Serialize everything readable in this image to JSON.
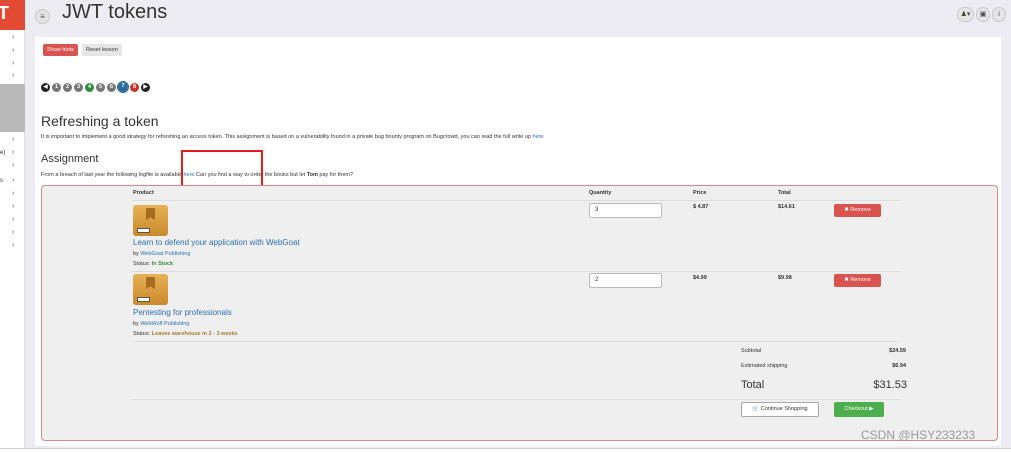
{
  "app": {
    "logo_letter": "T"
  },
  "header": {
    "title": "JWT tokens",
    "menu_glyph": "≡",
    "user_glyph": "♟▾",
    "monitor_glyph": "▣",
    "info_glyph": "i"
  },
  "sidebar": {
    "arrows": [
      "›",
      "›",
      "›",
      "›",
      "›",
      "›",
      "›",
      "›",
      "›",
      "›",
      "›",
      "›",
      "›",
      "›",
      "›"
    ],
    "fragments": [
      "e)",
      "s"
    ]
  },
  "toolbar": {
    "show_hints": "Show hints",
    "reset_lesson": "Reset lesson"
  },
  "pager": {
    "prev": "◀",
    "pages": [
      {
        "label": "1",
        "state": "gray"
      },
      {
        "label": "2",
        "state": "gray"
      },
      {
        "label": "3",
        "state": "gray"
      },
      {
        "label": "4",
        "state": "green"
      },
      {
        "label": "5",
        "state": "gray"
      },
      {
        "label": "6",
        "state": "gray"
      },
      {
        "label": "7",
        "state": "current"
      },
      {
        "label": "8",
        "state": "red"
      }
    ],
    "next": "▶"
  },
  "content": {
    "heading": "Refreshing a token",
    "intro": "It is important to implement a good strategy for refreshing an access token. This assignment is based on a vulnerability found in a private bug bounty program on Bugcrowd, you can read the full write up ",
    "intro_link": "here",
    "assignment_heading": "Assignment",
    "assign_before": "From a breach of last year the following logfile is available ",
    "assign_link": "here",
    "assign_mid": " Can you find a way to order the books but let ",
    "assign_bold": "Tom",
    "assign_after": " pay for them?"
  },
  "cart": {
    "columns": {
      "product": "Product",
      "quantity": "Quantity",
      "price": "Price",
      "total": "Total"
    },
    "items": [
      {
        "title": "Learn to defend your application with WebGoat",
        "by": "by ",
        "publisher": "WebGoat Publishing",
        "status_label": "Status: ",
        "status": "In Stock",
        "quantity": "3",
        "price": "$ 4.87",
        "total": "$14.61",
        "remove": "✖ Remove"
      },
      {
        "title": "Pentesting for professionals",
        "by": "by ",
        "publisher": "WebWolf Publishing",
        "status_label": "Status: ",
        "status": "Leaves warehouse in 2 - 3 weeks",
        "quantity": "2",
        "price": "$4.99",
        "total": "$9.98",
        "remove": "✖ Remove"
      }
    ],
    "subtotal_label": "Subtotal",
    "subtotal": "$24.59",
    "shipping_label": "Estimated shipping",
    "shipping": "$6.94",
    "total_label": "Total",
    "total": "$31.53",
    "continue": "🛒 Continue Shopping",
    "checkout": "Checkout ▶"
  },
  "watermark": "CSDN @HSY233233",
  "colors": {
    "accent_red": "#d9534f",
    "success_green": "#4cae4c",
    "link_blue": "#2a6fb5",
    "highlight_box": "#e01b1b"
  }
}
